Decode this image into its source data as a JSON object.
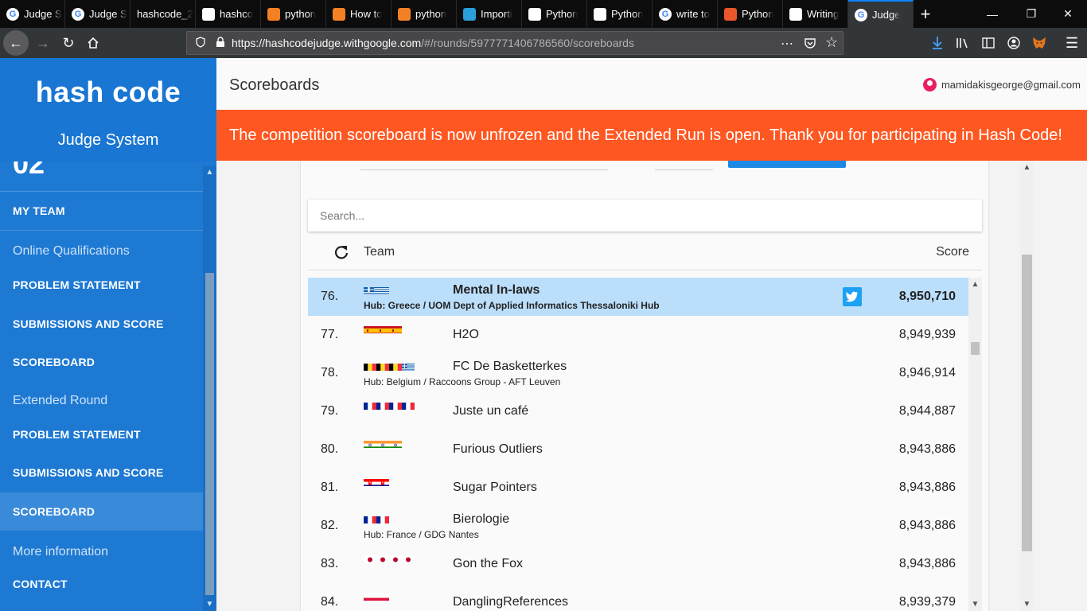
{
  "browser": {
    "tabs": [
      {
        "title": "Judge S",
        "icon": "google-icon",
        "color": "#ffffff"
      },
      {
        "title": "Judge S",
        "icon": "google-icon",
        "color": "#ffffff"
      },
      {
        "title": "hashcode_2",
        "icon": "",
        "color": ""
      },
      {
        "title": "hashco",
        "icon": "github-icon",
        "color": "#ffffff"
      },
      {
        "title": "python",
        "icon": "stackoverflow-icon",
        "color": "#f48024"
      },
      {
        "title": "How to",
        "icon": "stackoverflow-icon",
        "color": "#f48024"
      },
      {
        "title": "python",
        "icon": "stackoverflow-icon",
        "color": "#f48024"
      },
      {
        "title": "Importi",
        "icon": "loading-icon",
        "color": "#2b9fd9"
      },
      {
        "title": "Python",
        "icon": "w3schools-icon",
        "color": "#ffffff"
      },
      {
        "title": "Python",
        "icon": "geeksforgeeks-icon",
        "color": "#ffffff"
      },
      {
        "title": "write to",
        "icon": "google-icon",
        "color": "#ffffff"
      },
      {
        "title": "Python",
        "icon": "codecademy-icon",
        "color": "#e8562a"
      },
      {
        "title": "Writing",
        "icon": "geeksforgeeks-icon",
        "color": "#ffffff"
      },
      {
        "title": "Judge",
        "icon": "google-icon",
        "color": "#ffffff",
        "active": true
      }
    ],
    "url_host": "https://hashcodejudge.withgoogle.com",
    "url_path": "/#/rounds/5977771406786560/scoreboards"
  },
  "sidebar": {
    "brand": "hash code",
    "subtitle": "Judge System",
    "partial_number": "02",
    "items": [
      {
        "label": "MY TEAM",
        "type": "link"
      },
      {
        "label": "Online Qualifications",
        "type": "section"
      },
      {
        "label": "PROBLEM STATEMENT",
        "type": "link"
      },
      {
        "label": "SUBMISSIONS AND SCORE",
        "type": "link"
      },
      {
        "label": "SCOREBOARD",
        "type": "link"
      },
      {
        "label": "Extended Round",
        "type": "section"
      },
      {
        "label": "PROBLEM STATEMENT",
        "type": "link"
      },
      {
        "label": "SUBMISSIONS AND SCORE",
        "type": "link"
      },
      {
        "label": "SCOREBOARD",
        "type": "link",
        "active": true
      },
      {
        "label": "More information",
        "type": "section"
      },
      {
        "label": "CONTACT",
        "type": "link"
      }
    ]
  },
  "header": {
    "title": "Scoreboards",
    "user_email": "mamidakisgeorge@gmail.com"
  },
  "banner": {
    "text": "The competition scoreboard is now unfrozen and the Extended Run is open. Thank you for participating in Hash Code!",
    "color": "#ff5722"
  },
  "scoreboard": {
    "search_placeholder": "Search...",
    "col_team": "Team",
    "col_score": "Score",
    "rows": [
      {
        "rank": "76.",
        "team": "Mental In-laws",
        "hub": "Hub: Greece / UOM Dept of Applied Informatics Thessaloniki Hub",
        "score": "8,950,710",
        "flags": [
          "gr"
        ],
        "highlight": true,
        "twitter": true
      },
      {
        "rank": "77.",
        "team": "H2O",
        "hub": "",
        "score": "8,949,939",
        "flags": [
          "es",
          "es",
          "es"
        ]
      },
      {
        "rank": "78.",
        "team": "FC De Basketterkes",
        "hub": "Hub: Belgium / Raccoons Group - AFT Leuven",
        "score": "8,946,914",
        "flags": [
          "be",
          "be",
          "be",
          "gr"
        ]
      },
      {
        "rank": "79.",
        "team": "Juste un café",
        "hub": "",
        "score": "8,944,887",
        "flags": [
          "fr",
          "fr",
          "fr",
          "fr"
        ]
      },
      {
        "rank": "80.",
        "team": "Furious Outliers",
        "hub": "",
        "score": "8,943,886",
        "flags": [
          "in",
          "in",
          "in"
        ]
      },
      {
        "rank": "81.",
        "team": "Sugar Pointers",
        "hub": "",
        "score": "8,943,886",
        "flags": [
          "hr",
          "hr"
        ]
      },
      {
        "rank": "82.",
        "team": "Bierologie",
        "hub": "Hub: France / GDG Nantes",
        "score": "8,943,886",
        "flags": [
          "fr",
          "fr"
        ]
      },
      {
        "rank": "83.",
        "team": "Gon the Fox",
        "hub": "",
        "score": "8,943,886",
        "flags": [
          "jp",
          "jp",
          "jp",
          "jp"
        ]
      },
      {
        "rank": "84.",
        "team": "DanglingReferences",
        "hub": "",
        "score": "8,939,379",
        "flags": [
          "pl",
          "pl"
        ]
      }
    ]
  }
}
